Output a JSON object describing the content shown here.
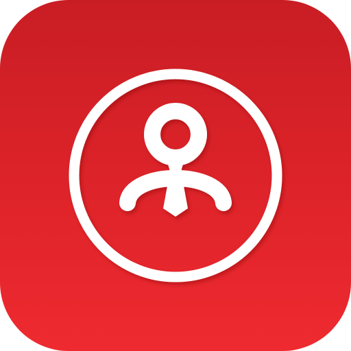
{
  "icon": {
    "name": "employee-profile-app-icon",
    "glyph": "person-with-tie-icon",
    "frame": "ring-outline",
    "colors": {
      "background_top": "#c91d24",
      "background_bottom": "#ee2a30",
      "foreground": "#ffffff",
      "shadow": "#8c0f14"
    }
  }
}
